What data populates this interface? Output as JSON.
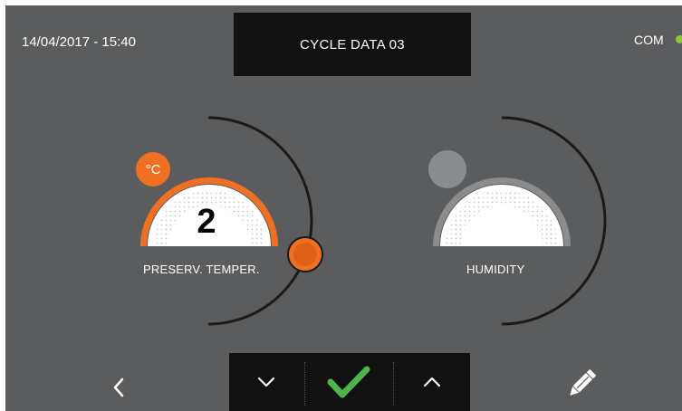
{
  "header": {
    "datetime": "14/04/2017 - 15:40",
    "title": "CYCLE DATA 03",
    "com_label": "COM"
  },
  "temperature_dial": {
    "unit": "°C",
    "value": "2",
    "label": "PRESERV. TEMPER."
  },
  "humidity_dial": {
    "label": "HUMIDITY"
  },
  "footer": {
    "icons": [
      "chevron-left-icon",
      "chevron-down-icon",
      "checkmark-icon",
      "chevron-up-icon",
      "pencil-icon"
    ]
  },
  "colors": {
    "background": "#5a5c5d",
    "panel": "#111111",
    "accent_orange": "#ef7022",
    "status_green": "#8cc63f",
    "confirm_green": "#4cb748",
    "inactive_grey": "#8a8c8e"
  }
}
